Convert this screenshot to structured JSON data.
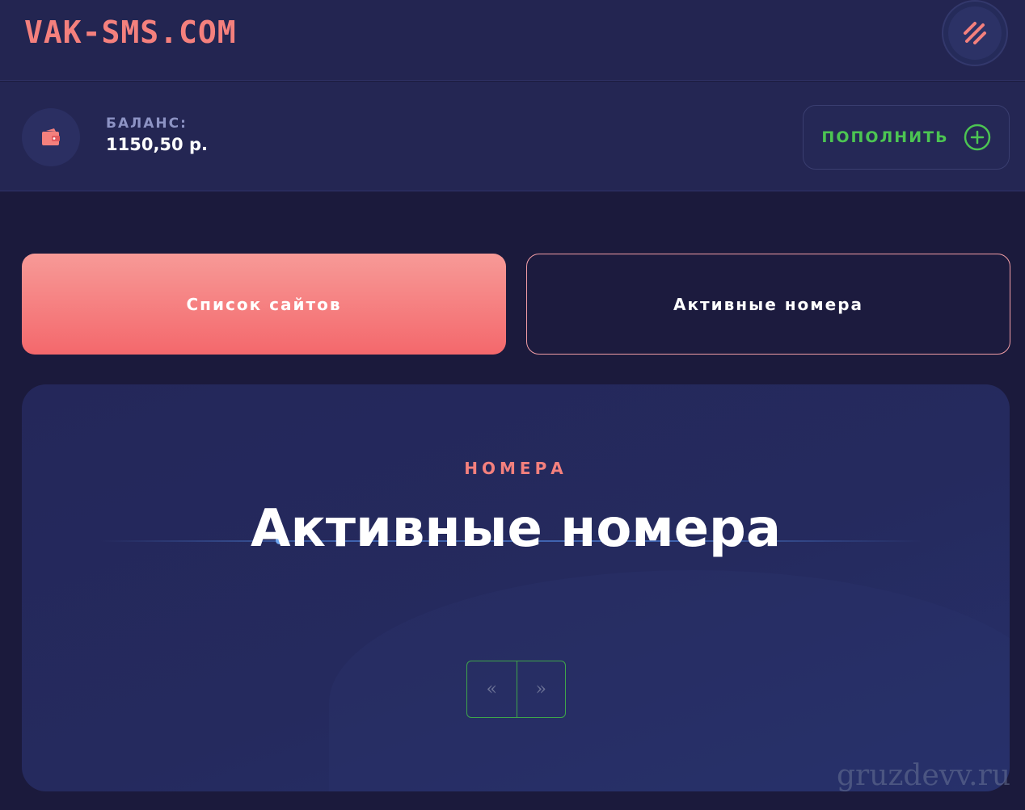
{
  "header": {
    "logo": "VAK-SMS.COM",
    "menu_icon": "slashes-icon"
  },
  "balance": {
    "wallet_icon": "wallet-icon",
    "label": "БАЛАНС:",
    "value": "1150,50 р.",
    "topup_label": "ПОПОЛНИТЬ",
    "topup_icon": "plus-circle-icon"
  },
  "tabs": [
    {
      "label": "Список сайтов",
      "active": true
    },
    {
      "label": "Активные номера",
      "active": false
    }
  ],
  "panel": {
    "kicker": "НОМЕРА",
    "title": "Активные номера",
    "pager": {
      "prev": "«",
      "next": "»"
    }
  },
  "watermark": "gruzdevv.ru",
  "colors": {
    "accent": "#f4807d",
    "green": "#4cc552",
    "background": "#1b1a3c"
  }
}
